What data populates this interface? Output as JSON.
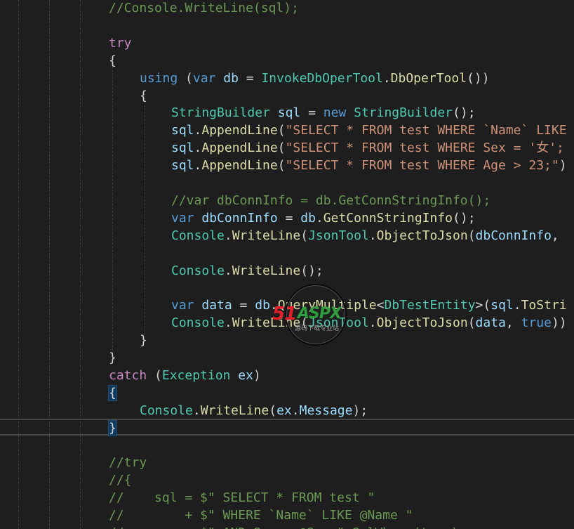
{
  "lines": [
    [
      [
        "cmt",
        "//Console.WriteLine(sql);"
      ]
    ],
    [],
    [
      [
        "ctl",
        "try"
      ]
    ],
    [
      [
        "pun",
        "{"
      ]
    ],
    [
      [
        "kw",
        "using"
      ],
      [
        "pun",
        " ("
      ],
      [
        "kw",
        "var"
      ],
      [
        "pun",
        " "
      ],
      [
        "var",
        "db"
      ],
      [
        "pun",
        " = "
      ],
      [
        "type",
        "InvokeDbOperTool"
      ],
      [
        "pun",
        "."
      ],
      [
        "fn",
        "DbOperTool"
      ],
      [
        "pun",
        "())"
      ]
    ],
    [
      [
        "pun",
        "{"
      ]
    ],
    [
      [
        "type",
        "StringBuilder"
      ],
      [
        "pun",
        " "
      ],
      [
        "var",
        "sql"
      ],
      [
        "pun",
        " = "
      ],
      [
        "kw",
        "new"
      ],
      [
        "pun",
        " "
      ],
      [
        "type",
        "StringBuilder"
      ],
      [
        "pun",
        "();"
      ]
    ],
    [
      [
        "var",
        "sql"
      ],
      [
        "pun",
        "."
      ],
      [
        "fn",
        "AppendLine"
      ],
      [
        "pun",
        "("
      ],
      [
        "str",
        "\"SELECT * FROM test WHERE `Name` LIKE"
      ]
    ],
    [
      [
        "var",
        "sql"
      ],
      [
        "pun",
        "."
      ],
      [
        "fn",
        "AppendLine"
      ],
      [
        "pun",
        "("
      ],
      [
        "str",
        "\"SELECT * FROM test WHERE Sex = '女';"
      ]
    ],
    [
      [
        "var",
        "sql"
      ],
      [
        "pun",
        "."
      ],
      [
        "fn",
        "AppendLine"
      ],
      [
        "pun",
        "("
      ],
      [
        "str",
        "\"SELECT * FROM test WHERE Age > 23;\""
      ],
      [
        "pun",
        ")"
      ]
    ],
    [],
    [
      [
        "cmt",
        "//var dbConnInfo = db.GetConnStringInfo();"
      ]
    ],
    [
      [
        "kw",
        "var"
      ],
      [
        "pun",
        " "
      ],
      [
        "var",
        "dbConnInfo"
      ],
      [
        "pun",
        " = "
      ],
      [
        "var",
        "db"
      ],
      [
        "pun",
        "."
      ],
      [
        "fn",
        "GetConnStringInfo"
      ],
      [
        "pun",
        "();"
      ]
    ],
    [
      [
        "type",
        "Console"
      ],
      [
        "pun",
        "."
      ],
      [
        "fn",
        "WriteLine"
      ],
      [
        "pun",
        "("
      ],
      [
        "type",
        "JsonTool"
      ],
      [
        "pun",
        "."
      ],
      [
        "fn",
        "ObjectToJson"
      ],
      [
        "pun",
        "("
      ],
      [
        "var",
        "dbConnInfo"
      ],
      [
        "pun",
        ","
      ]
    ],
    [],
    [
      [
        "type",
        "Console"
      ],
      [
        "pun",
        "."
      ],
      [
        "fn",
        "WriteLine"
      ],
      [
        "pun",
        "();"
      ]
    ],
    [],
    [
      [
        "kw",
        "var"
      ],
      [
        "pun",
        " "
      ],
      [
        "var",
        "data"
      ],
      [
        "pun",
        " = "
      ],
      [
        "var",
        "db"
      ],
      [
        "pun",
        "."
      ],
      [
        "fn",
        "QueryMultiple"
      ],
      [
        "pun",
        "<"
      ],
      [
        "type",
        "DbTestEntity"
      ],
      [
        "pun",
        ">("
      ],
      [
        "var",
        "sql"
      ],
      [
        "pun",
        "."
      ],
      [
        "fn",
        "ToStri"
      ]
    ],
    [
      [
        "type",
        "Console"
      ],
      [
        "pun",
        "."
      ],
      [
        "fn",
        "WriteLine"
      ],
      [
        "pun",
        "("
      ],
      [
        "type",
        "JsonTool"
      ],
      [
        "pun",
        "."
      ],
      [
        "fn",
        "ObjectToJson"
      ],
      [
        "pun",
        "("
      ],
      [
        "var",
        "data"
      ],
      [
        "pun",
        ", "
      ],
      [
        "kw",
        "true"
      ],
      [
        "pun",
        "))"
      ]
    ],
    [
      [
        "pun",
        "}"
      ]
    ],
    [
      [
        "pun",
        "}"
      ]
    ],
    [
      [
        "ctl",
        "catch"
      ],
      [
        "pun",
        " ("
      ],
      [
        "type",
        "Exception"
      ],
      [
        "pun",
        " "
      ],
      [
        "var",
        "ex"
      ],
      [
        "pun",
        ")"
      ]
    ],
    [
      [
        "brace",
        "{"
      ]
    ],
    [
      [
        "type",
        "Console"
      ],
      [
        "pun",
        "."
      ],
      [
        "fn",
        "WriteLine"
      ],
      [
        "pun",
        "("
      ],
      [
        "var",
        "ex"
      ],
      [
        "pun",
        "."
      ],
      [
        "var",
        "Message"
      ],
      [
        "pun",
        ");"
      ]
    ],
    [
      [
        "brace",
        "}"
      ]
    ],
    [],
    [
      [
        "cmt",
        "//try"
      ]
    ],
    [
      [
        "cmt",
        "//{"
      ]
    ],
    [
      [
        "cmt",
        "//    sql = $\" SELECT * FROM test \""
      ]
    ],
    [
      [
        "cmt",
        "//        + $\" WHERE `Name` LIKE @Name \""
      ]
    ],
    [
      [
        "cmt",
        "//        + $\" AND Sex = @Sex \" SqlWhere(true);"
      ]
    ]
  ],
  "watermark": {
    "brand_num": "51",
    "brand_txt": "ASPX",
    "brand_sub": "源码下载专业站"
  }
}
